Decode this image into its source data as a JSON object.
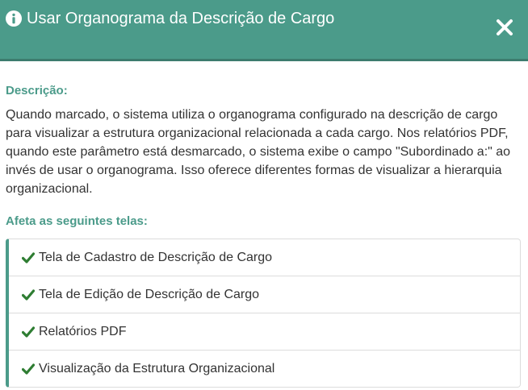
{
  "dialog": {
    "title": "Usar Organograma da Descrição de Cargo",
    "info_icon": "info-circle-icon",
    "close_icon": "close-icon"
  },
  "description": {
    "label": "Descrição:",
    "text": "Quando marcado, o sistema utiliza o organograma configurado na descrição de cargo para visualizar a estrutura organizacional relacionada a cada cargo. Nos relatórios PDF, quando este parâmetro está desmarcado, o sistema exibe o campo \"Subordinado a:\" ao invés de usar o organograma. Isso oferece diferentes formas de visualizar a hierarquia organizacional."
  },
  "affects": {
    "label": "Afeta as seguintes telas:",
    "item_icon": "check-icon",
    "items": [
      "Tela de Cadastro de Descrição de Cargo",
      "Tela de Edição de Descrição de Cargo",
      "Relatórios PDF",
      "Visualização da Estrutura Organizacional"
    ]
  },
  "colors": {
    "header": "#4b9b8a",
    "accent": "#4b9b8a",
    "check": "#2e7d32"
  }
}
